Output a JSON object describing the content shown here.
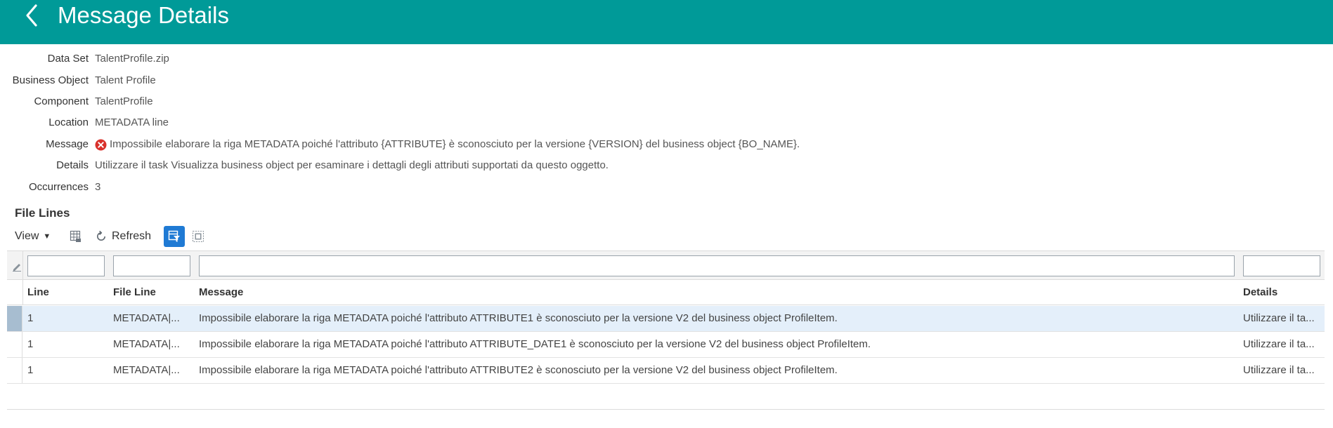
{
  "header": {
    "title": "Message Details",
    "back_icon": "chevron-left-icon",
    "background_color": "#009a98"
  },
  "details": [
    {
      "label": "Data Set",
      "value": "TalentProfile.zip"
    },
    {
      "label": "Business Object",
      "value": "Talent Profile"
    },
    {
      "label": "Component",
      "value": "TalentProfile"
    },
    {
      "label": "Location",
      "value": "METADATA line"
    },
    {
      "label": "Message",
      "value": "Impossibile elaborare la riga METADATA poiché l'attributo {ATTRIBUTE} è sconosciuto per la versione {VERSION} del business object {BO_NAME}.",
      "icon": "error-icon"
    },
    {
      "label": "Details",
      "value": "Utilizzare il task Visualizza business object per esaminare i dettagli degli attributi supportati da questo oggetto."
    },
    {
      "label": "Occurrences",
      "value": "3"
    }
  ],
  "file_lines": {
    "title": "File Lines",
    "toolbar": {
      "view_label": "View",
      "refresh_label": "Refresh",
      "filter_active_color": "#1f7ad4"
    },
    "filters": {
      "line": "",
      "file_line": "",
      "message": "",
      "details": ""
    },
    "columns": [
      "Line",
      "File Line",
      "Message",
      "Details"
    ],
    "rows": [
      {
        "line": "1",
        "file_line": "METADATA|...",
        "message": "Impossibile elaborare la riga METADATA poiché l'attributo ATTRIBUTE1 è sconosciuto per la versione V2 del business object ProfileItem.",
        "details": "Utilizzare il ta...",
        "selected": true
      },
      {
        "line": "1",
        "file_line": "METADATA|...",
        "message": "Impossibile elaborare la riga METADATA poiché l'attributo ATTRIBUTE_DATE1 è sconosciuto per la versione V2 del business object ProfileItem.",
        "details": "Utilizzare il ta...",
        "selected": false
      },
      {
        "line": "1",
        "file_line": "METADATA|...",
        "message": "Impossibile elaborare la riga METADATA poiché l'attributo ATTRIBUTE2 è sconosciuto per la versione V2 del business object ProfileItem.",
        "details": "Utilizzare il ta...",
        "selected": false
      }
    ]
  }
}
